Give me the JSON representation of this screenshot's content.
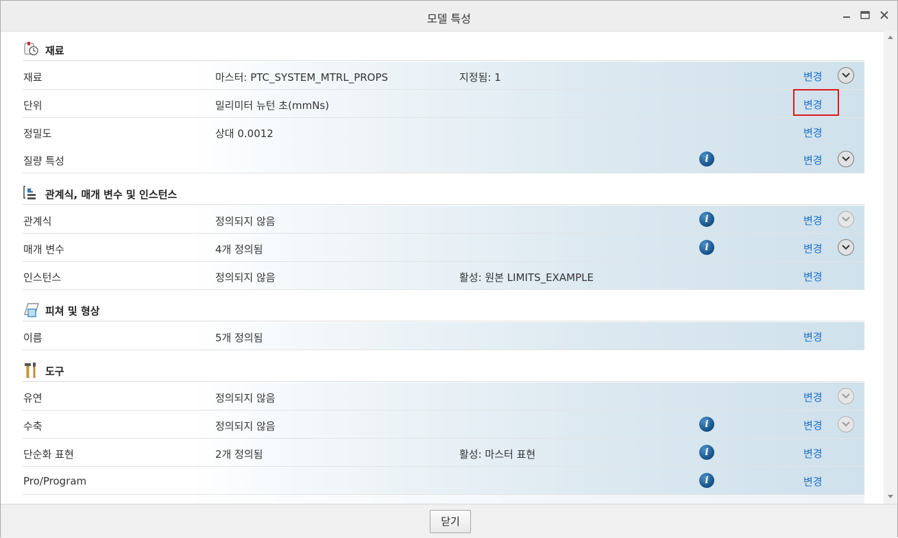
{
  "window": {
    "title": "모델 특성"
  },
  "sections": [
    {
      "label": "재료",
      "icon": "material-icon"
    },
    {
      "label": "관계식, 매개 변수 및 인스턴스",
      "icon": "relations-icon"
    },
    {
      "label": "피쳐 및 형상",
      "icon": "features-icon"
    },
    {
      "label": "도구",
      "icon": "tools-icon"
    }
  ],
  "rows": [
    {
      "name": "재료",
      "value": "마스터: PTC_SYSTEM_MTRL_PROPS",
      "extra": "지정됨: 1",
      "info": false,
      "change": "변경",
      "expand": "active"
    },
    {
      "name": "단위",
      "value": "밀리미터 뉴턴 초(mmNs)",
      "extra": "",
      "info": false,
      "change": "변경",
      "expand": "none"
    },
    {
      "name": "정밀도",
      "value": "상대 0.0012",
      "extra": "",
      "info": false,
      "change": "변경",
      "expand": "none"
    },
    {
      "name": "질량 특성",
      "value": "",
      "extra": "",
      "info": true,
      "change": "변경",
      "expand": "active"
    },
    {
      "name": "관계식",
      "value": "정의되지 않음",
      "extra": "",
      "info": true,
      "change": "변경",
      "expand": "disabled"
    },
    {
      "name": "매개 변수",
      "value": "4개 정의됨",
      "extra": "",
      "info": true,
      "change": "변경",
      "expand": "active"
    },
    {
      "name": "인스턴스",
      "value": "정의되지 않음",
      "extra": "활성: 원본 LIMITS_EXAMPLE",
      "info": false,
      "change": "변경",
      "expand": "none"
    },
    {
      "name": "이름",
      "value": "5개 정의됨",
      "extra": "",
      "info": false,
      "change": "변경",
      "expand": "none"
    },
    {
      "name": "유연",
      "value": "정의되지 않음",
      "extra": "",
      "info": false,
      "change": "변경",
      "expand": "disabled"
    },
    {
      "name": "수축",
      "value": "정의되지 않음",
      "extra": "",
      "info": true,
      "change": "변경",
      "expand": "disabled"
    },
    {
      "name": "단순화 표현",
      "value": "2개 정의됨",
      "extra": "활성: 마스터 표현",
      "info": true,
      "change": "변경",
      "expand": "none"
    },
    {
      "name": "Pro/Program",
      "value": "",
      "extra": "",
      "info": true,
      "change": "변경",
      "expand": "none"
    }
  ],
  "footer": {
    "close_label": "닫기"
  }
}
